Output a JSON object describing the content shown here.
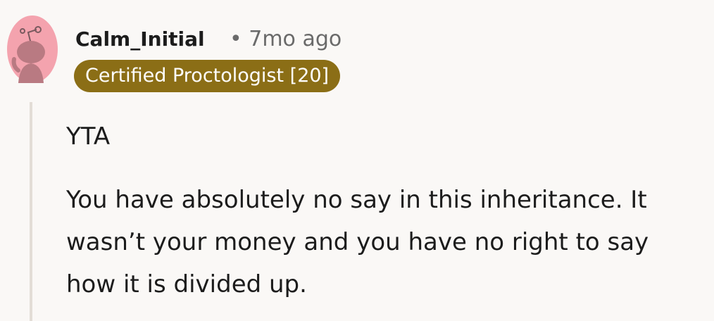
{
  "comment": {
    "username": "Calm_Initial",
    "separator": "•",
    "age": "7mo ago",
    "flair": "Certified Proctologist [20]",
    "paragraphs": [
      "YTA",
      "You have absolutely no say in this inheritance. It wasn’t your money and you have no right to say how it is divided up."
    ],
    "avatar": {
      "icon": "snoo-avatar-icon",
      "background_color": "#f4a3ae",
      "figure_color": "#b97a82"
    },
    "flair_color": "#8b6e16"
  }
}
